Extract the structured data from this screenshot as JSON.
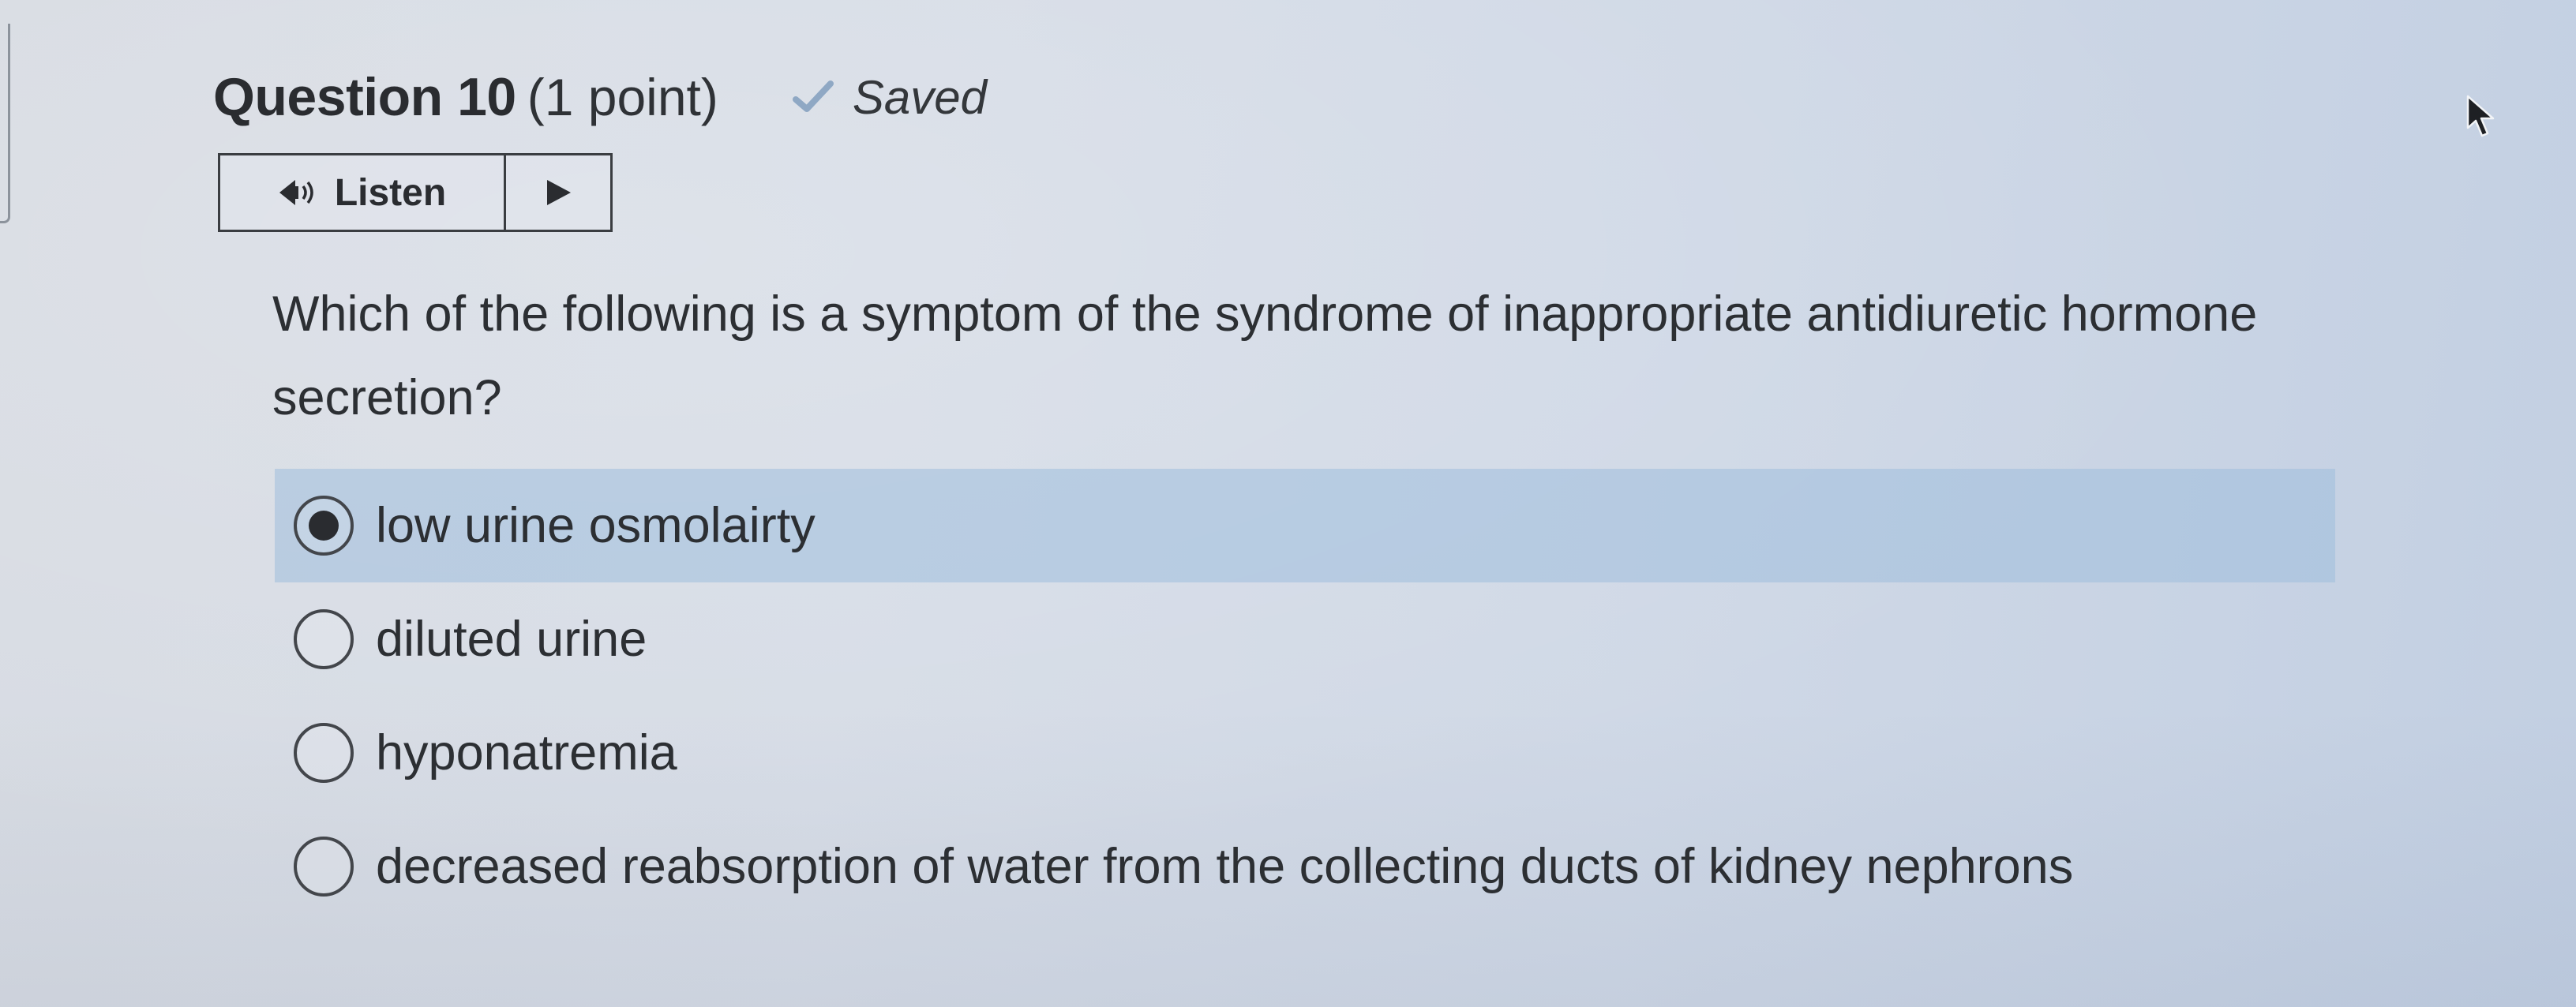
{
  "question": {
    "title": "Question 10",
    "points": "(1 point)",
    "saved_label": "Saved",
    "prompt": "Which of the following is a symptom of the syndrome of inappropriate antidiuretic hormone secretion?"
  },
  "listen": {
    "label": "Listen",
    "speaker_icon": "speaker-icon",
    "play_icon": "play-icon"
  },
  "options": [
    {
      "label": "low urine osmolairty",
      "selected": true
    },
    {
      "label": "diluted urine",
      "selected": false
    },
    {
      "label": "hyponatremia",
      "selected": false
    },
    {
      "label": "decreased reabsorption of water from the collecting ducts of kidney nephrons",
      "selected": false
    }
  ],
  "colors": {
    "selected_highlight": "#9ebedd",
    "check_mark": "#8fa8c4"
  }
}
